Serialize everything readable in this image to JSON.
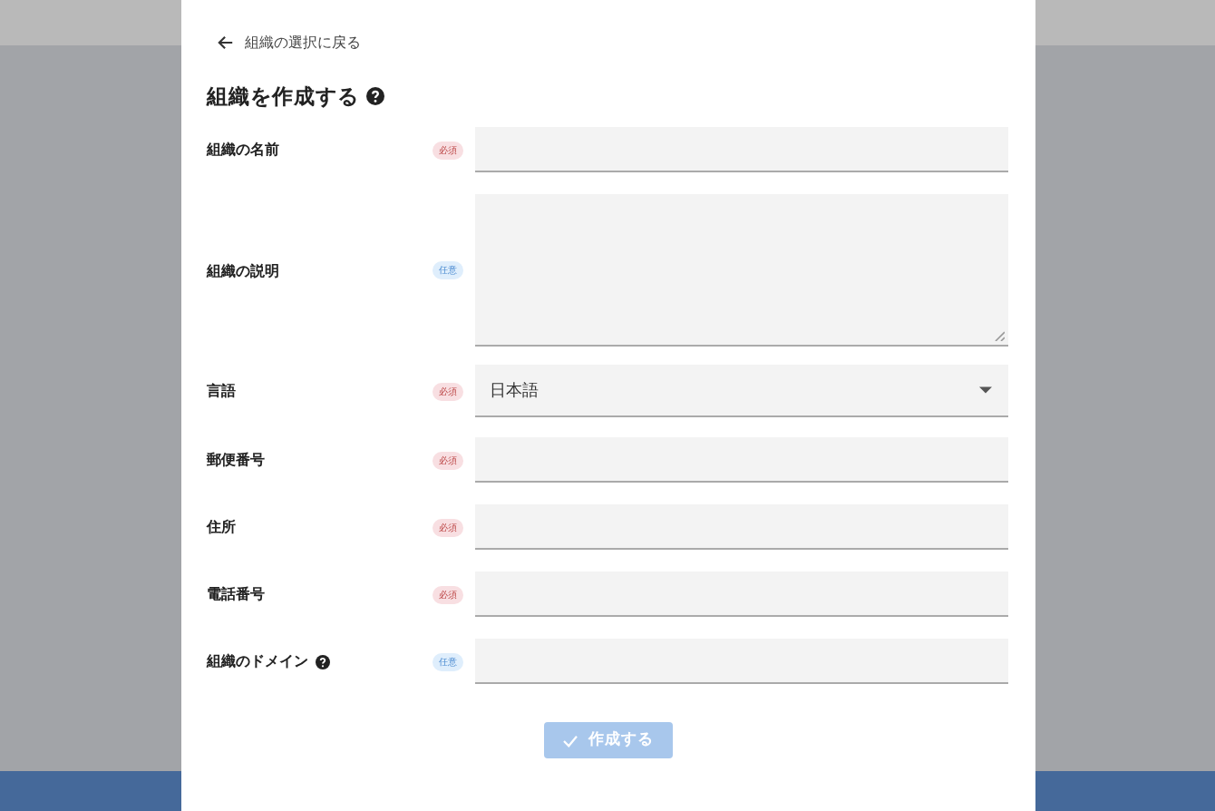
{
  "back_link": "組織の選択に戻る",
  "title": "組織を作成する",
  "fields": [
    {
      "label": "組織の名前",
      "required": true,
      "badge": "必須",
      "kind": "text",
      "help": false
    },
    {
      "label": "組織の説明",
      "required": false,
      "badge": "任意",
      "kind": "textarea",
      "help": false
    },
    {
      "label": "言語",
      "required": true,
      "badge": "必須",
      "kind": "select",
      "value": "日本語",
      "help": false
    },
    {
      "label": "郵便番号",
      "required": true,
      "badge": "必須",
      "kind": "text",
      "help": false
    },
    {
      "label": "住所",
      "required": true,
      "badge": "必須",
      "kind": "text",
      "help": false
    },
    {
      "label": "電話番号",
      "required": true,
      "badge": "必須",
      "kind": "text",
      "help": false
    },
    {
      "label": "組織のドメイン",
      "required": false,
      "badge": "任意",
      "kind": "text",
      "help": true
    }
  ],
  "submit": {
    "label": "作成する",
    "disabled": true
  }
}
